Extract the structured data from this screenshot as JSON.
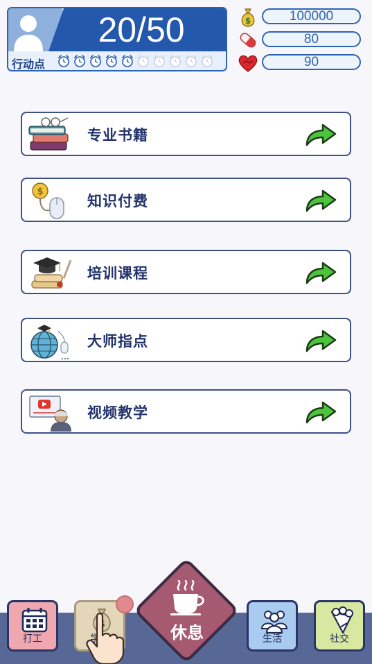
{
  "header": {
    "action_points": "20/50",
    "action_points_label": "行动点",
    "clocks": {
      "total": 10,
      "filled": 5
    }
  },
  "resources": [
    {
      "icon": "money-bag-icon",
      "value": "100000"
    },
    {
      "icon": "pill-icon",
      "value": "80"
    },
    {
      "icon": "heart-handshake-icon",
      "value": "90"
    }
  ],
  "menu": [
    {
      "label": "专业书籍",
      "icon": "books-icon"
    },
    {
      "label": "知识付费",
      "icon": "coin-mouse-icon"
    },
    {
      "label": "培训课程",
      "icon": "graduation-diploma-icon"
    },
    {
      "label": "大师指点",
      "icon": "globe-mouse-icon"
    },
    {
      "label": "视频教学",
      "icon": "video-lecture-icon"
    }
  ],
  "nav": {
    "work": "打工",
    "study": "学习",
    "rest": "休息",
    "life": "生活",
    "social": "社交"
  },
  "colors": {
    "accent_blue": "#2458ad",
    "nav_bar": "#576796",
    "work_btn": "#f0a8b0",
    "study_btn": "#e4d6b8",
    "rest_btn": "#a55a72",
    "life_btn": "#aacbf0",
    "social_btn": "#d8e8a0",
    "arrow_green": "#4cc43c"
  }
}
